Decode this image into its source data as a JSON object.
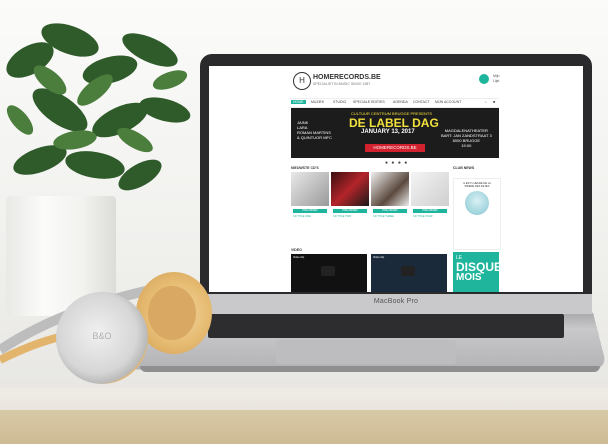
{
  "scene": {
    "laptop_brand": "MacBook Pro",
    "headphone_logo": "B&O"
  },
  "site": {
    "logo_text": "HOMERECORDS.BE",
    "logo_sub": "SPECIALIST IN MUSIC SINCE 1987",
    "logo_mark": "H",
    "header_right": [
      "Mijn",
      "Lijst"
    ],
    "nav": [
      {
        "label": "HOME",
        "active": true
      },
      {
        "label": "MUZIEK",
        "active": false
      },
      {
        "label": "STUDIO",
        "active": false
      },
      {
        "label": "SPECIALE EDITIES",
        "active": false
      },
      {
        "label": "AGENDA",
        "active": false
      },
      {
        "label": "CONTACT",
        "active": false
      },
      {
        "label": "MIJN ACCOUNT",
        "active": false
      }
    ],
    "banner": {
      "left_lines": [
        "JAINK",
        "LARA",
        "ROMAN MARTINS",
        "& QUINTUOR MFC"
      ],
      "kicker": "CULTUUR CENTRUM BRUGGE PRESENTS",
      "title": "DE LABEL DAG",
      "date": "JANUARY 13, 2017",
      "right_lines": [
        "MAGDALENATHEATER",
        "BART: JAN ZANDSTRAAT 3",
        "8000 BRUGGE",
        "19:00"
      ],
      "logo": "HOMERECORDS.BE"
    },
    "section_new": "NIEUWSTE CD'S",
    "section_video": "VIDEO",
    "section_side": "CLUB NEWS",
    "tiles": [
      {
        "button": "PRE-ORDER",
        "caption": "CD TITLE ONE"
      },
      {
        "button": "PRE-ORDER",
        "caption": "CD TITLE TWO"
      },
      {
        "button": "PRE-ORDER",
        "caption": "CD TITLE THREE"
      },
      {
        "button": "PRE-ORDER",
        "caption": "CD TITLE FOUR"
      }
    ],
    "side_card_text": [
      "IL EST L'HEURE DE LA",
      "PRIERE DES FETES"
    ],
    "side2": {
      "line1": "LE",
      "line2": "DISQUE",
      "line3": "MOIS"
    },
    "videos": [
      {
        "title": "Video clip"
      },
      {
        "title": "Video clip"
      }
    ]
  }
}
